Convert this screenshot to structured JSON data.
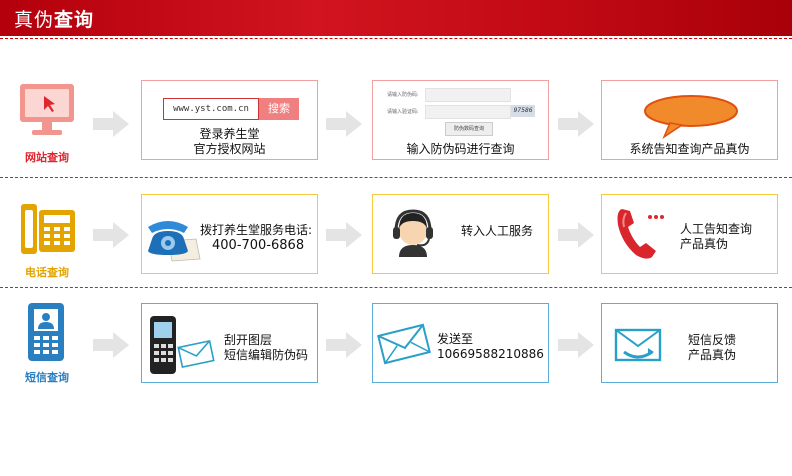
{
  "header": {
    "title_light": "真伪",
    "title_bold": "查询"
  },
  "rows": {
    "web": {
      "label": "网站查询",
      "step1": {
        "url": "www.yst.com.cn",
        "search_label": "搜索",
        "line1": "登录养生堂",
        "line2": "官方授权网站"
      },
      "step2": {
        "field1_label": "请输入防伪码:",
        "field2_label": "请输入验证码:",
        "captcha": "97586",
        "button_label": "防伪数码查询",
        "caption": "输入防伪码进行查询"
      },
      "step3": {
        "caption": "系统告知查询产品真伪"
      }
    },
    "phone": {
      "label": "电话查询",
      "step1": {
        "line1": "拨打养生堂服务电话:",
        "line2": "400-700-6868"
      },
      "step2": {
        "caption": "转入人工服务"
      },
      "step3": {
        "line1": "人工告知查询",
        "line2": "产品真伪"
      }
    },
    "sms": {
      "label": "短信查询",
      "step1": {
        "line1": "刮开图层",
        "line2": "短信编辑防伪码"
      },
      "step2": {
        "line1": "发送至",
        "line2": "10669588210886"
      },
      "step3": {
        "line1": "短信反馈",
        "line2": "产品真伪"
      }
    }
  },
  "colors": {
    "web": "#e0262e",
    "phone": "#e3a400",
    "sms": "#2a7fc0",
    "web_border": "#f0a0a0",
    "phone_border": "#f5c842",
    "sms_border": "#5aaed8"
  }
}
